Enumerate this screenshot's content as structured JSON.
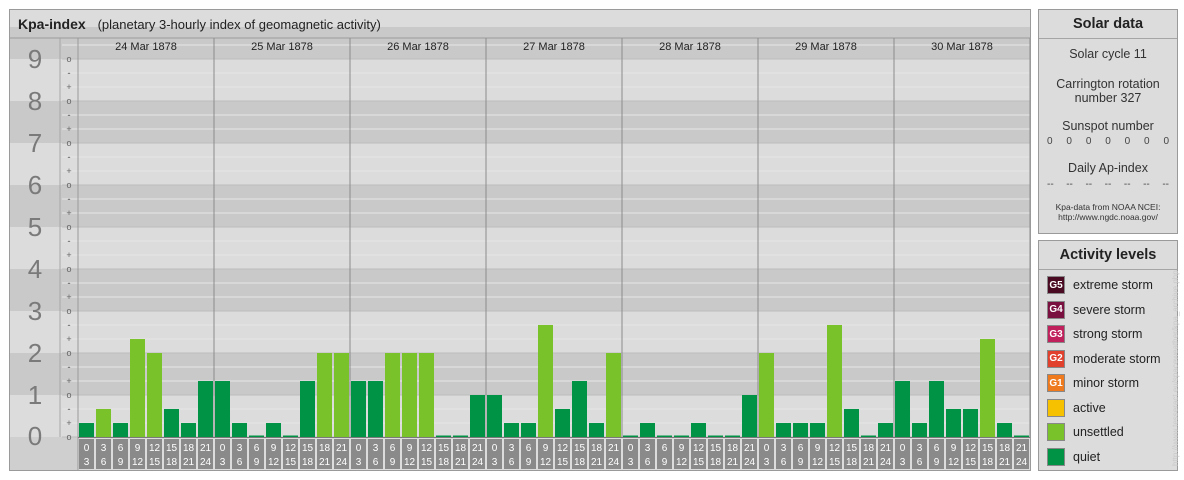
{
  "header": {
    "title": "Kpa-index",
    "subtitle": "(planetary 3-hourly index of geomagnetic activity)"
  },
  "chart_data": {
    "type": "bar",
    "ylim": [
      0,
      9
    ],
    "y_ticks": [
      "0",
      "1",
      "2",
      "3",
      "4",
      "5",
      "6",
      "7",
      "8",
      "9"
    ],
    "minor_ticks": [
      "o",
      "+",
      "-"
    ],
    "dates": [
      "24 Mar 1878",
      "25 Mar 1878",
      "26 Mar 1878",
      "27 Mar 1878",
      "28 Mar 1878",
      "29 Mar 1878",
      "30 Mar 1878"
    ],
    "interval_labels": [
      [
        "0",
        "3"
      ],
      [
        "3",
        "6"
      ],
      [
        "6",
        "9"
      ],
      [
        "9",
        "12"
      ],
      [
        "12",
        "15"
      ],
      [
        "15",
        "18"
      ],
      [
        "18",
        "21"
      ],
      [
        "21",
        "24"
      ]
    ],
    "values": [
      [
        0.333,
        0.667,
        0.333,
        2.333,
        2.0,
        0.667,
        0.333,
        1.333
      ],
      [
        1.333,
        0.333,
        0.0,
        0.333,
        0.0,
        1.333,
        2.0,
        2.0
      ],
      [
        1.333,
        1.333,
        2.0,
        2.0,
        2.0,
        0.0,
        0.0,
        1.0
      ],
      [
        1.0,
        0.333,
        0.333,
        2.667,
        0.667,
        1.333,
        0.333,
        2.0
      ],
      [
        0.0,
        0.333,
        0.0,
        0.0,
        0.333,
        0.0,
        0.0,
        1.0
      ],
      [
        2.0,
        0.333,
        0.333,
        0.333,
        2.667,
        0.667,
        0.0,
        0.333
      ],
      [
        1.333,
        0.333,
        1.333,
        0.667,
        0.667,
        2.333,
        0.333,
        0.0
      ]
    ],
    "categories": [
      [
        0,
        1,
        0,
        1,
        1,
        0,
        0,
        0
      ],
      [
        0,
        0,
        0,
        0,
        0,
        0,
        1,
        1
      ],
      [
        0,
        0,
        1,
        1,
        1,
        0,
        0,
        0
      ],
      [
        0,
        0,
        0,
        1,
        0,
        0,
        0,
        1
      ],
      [
        0,
        0,
        0,
        0,
        0,
        0,
        0,
        0
      ],
      [
        1,
        0,
        0,
        0,
        1,
        0,
        0,
        0
      ],
      [
        0,
        0,
        0,
        0,
        0,
        1,
        0,
        0
      ]
    ],
    "category_names": [
      "quiet",
      "unsettled"
    ]
  },
  "colors": {
    "quiet": "#009245",
    "unsettled": "#7ac22a"
  },
  "solar": {
    "title": "Solar data",
    "cycle": "Solar cycle 11",
    "carrington_1": "Carrington rotation",
    "carrington_2": "number 327",
    "sunspot_label": "Sunspot number",
    "sunspot_values": [
      "0",
      "0",
      "0",
      "0",
      "0",
      "0",
      "0"
    ],
    "ap_label": "Daily Ap-index",
    "ap_values": [
      "--",
      "--",
      "--",
      "--",
      "--",
      "--",
      "--"
    ],
    "credit_1": "Kpa-data from NOAA NCEI:",
    "credit_2": "http://www.ngdc.noaa.gov/"
  },
  "activity": {
    "title": "Activity levels",
    "levels": [
      {
        "code": "G5",
        "label": "extreme storm",
        "color": "#4a0b22"
      },
      {
        "code": "G4",
        "label": "severe storm",
        "color": "#7a1040"
      },
      {
        "code": "G3",
        "label": "strong storm",
        "color": "#c0205c"
      },
      {
        "code": "G2",
        "label": "moderate storm",
        "color": "#e0402c"
      },
      {
        "code": "G1",
        "label": "minor storm",
        "color": "#ef7a1e"
      },
      {
        "code": "",
        "label": "active",
        "color": "#f6c200"
      },
      {
        "code": "",
        "label": "unsettled",
        "color": "#7ac22a"
      },
      {
        "code": "",
        "label": "quiet",
        "color": "#009245"
      }
    ]
  },
  "watermark": "http://www.tesseract.eu/spaceweather/kpa_archive.php"
}
